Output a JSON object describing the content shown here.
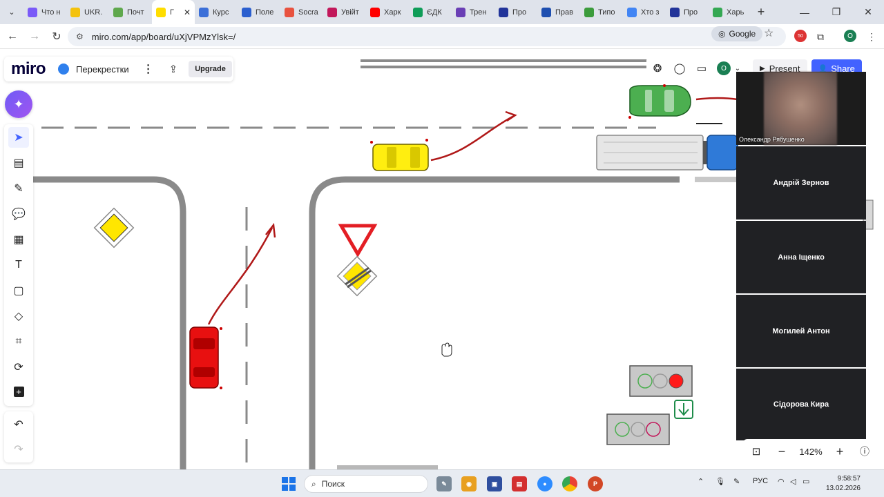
{
  "browser": {
    "tabs": [
      {
        "label": "Что н",
        "color": "#7a5af8"
      },
      {
        "label": "UKR.",
        "color": "#f4c20d"
      },
      {
        "label": "Почт",
        "color": "#5fa84d"
      },
      {
        "label": "Г",
        "color": "#ffdd00",
        "active": true
      },
      {
        "label": "Курс",
        "color": "#3b6fd8"
      },
      {
        "label": "Поле",
        "color": "#2b5fcf"
      },
      {
        "label": "Socra",
        "color": "#e8523f"
      },
      {
        "label": "Увійт",
        "color": "#c2185b"
      },
      {
        "label": "Харк",
        "color": "#ff0000"
      },
      {
        "label": "ЄДК",
        "color": "#0f9d58"
      },
      {
        "label": "Трен",
        "color": "#6a3fb5"
      },
      {
        "label": "Про",
        "color": "#22349a"
      },
      {
        "label": "Прав",
        "color": "#1e4fb0"
      },
      {
        "label": "Типо",
        "color": "#3c9c3c"
      },
      {
        "label": "Хто з",
        "color": "#4285f4"
      },
      {
        "label": "Про",
        "color": "#22349a"
      },
      {
        "label": "Харь",
        "color": "#34a853"
      }
    ],
    "url": "miro.com/app/board/uXjVPMzYlsk=/",
    "search_engine_chip": "Google",
    "extension_badge": "50",
    "profile_initial": "O"
  },
  "board": {
    "logo": "miro",
    "title": "Перекрестки",
    "upgrade_label": "Upgrade",
    "present_label": "Present",
    "share_label": "Share",
    "avatar_initial": "O",
    "zoom_level": "142%"
  },
  "participants": [
    {
      "name": "Олександр Рябушенко",
      "camera": true
    },
    {
      "name": "Андрій Зернов"
    },
    {
      "name": "Анна Іщенко"
    },
    {
      "name": "Могилей Антон"
    },
    {
      "name": "Сідорова Кира"
    }
  ],
  "taskbar": {
    "search_placeholder": "Поиск",
    "language": "РУС",
    "time": "9:58:57",
    "date": "13.02.2026"
  },
  "colors": {
    "accent": "#4262ff",
    "road": "#8a8a8a",
    "arrow": "#b01818",
    "car_red": "#e81010",
    "car_yellow": "#ffee10",
    "car_green": "#4caf50",
    "truck_blue": "#2f7ad8",
    "priority_sign": "#ffe600",
    "light_red": "#ff1a1a",
    "green_sign": "#1e8c4a"
  }
}
